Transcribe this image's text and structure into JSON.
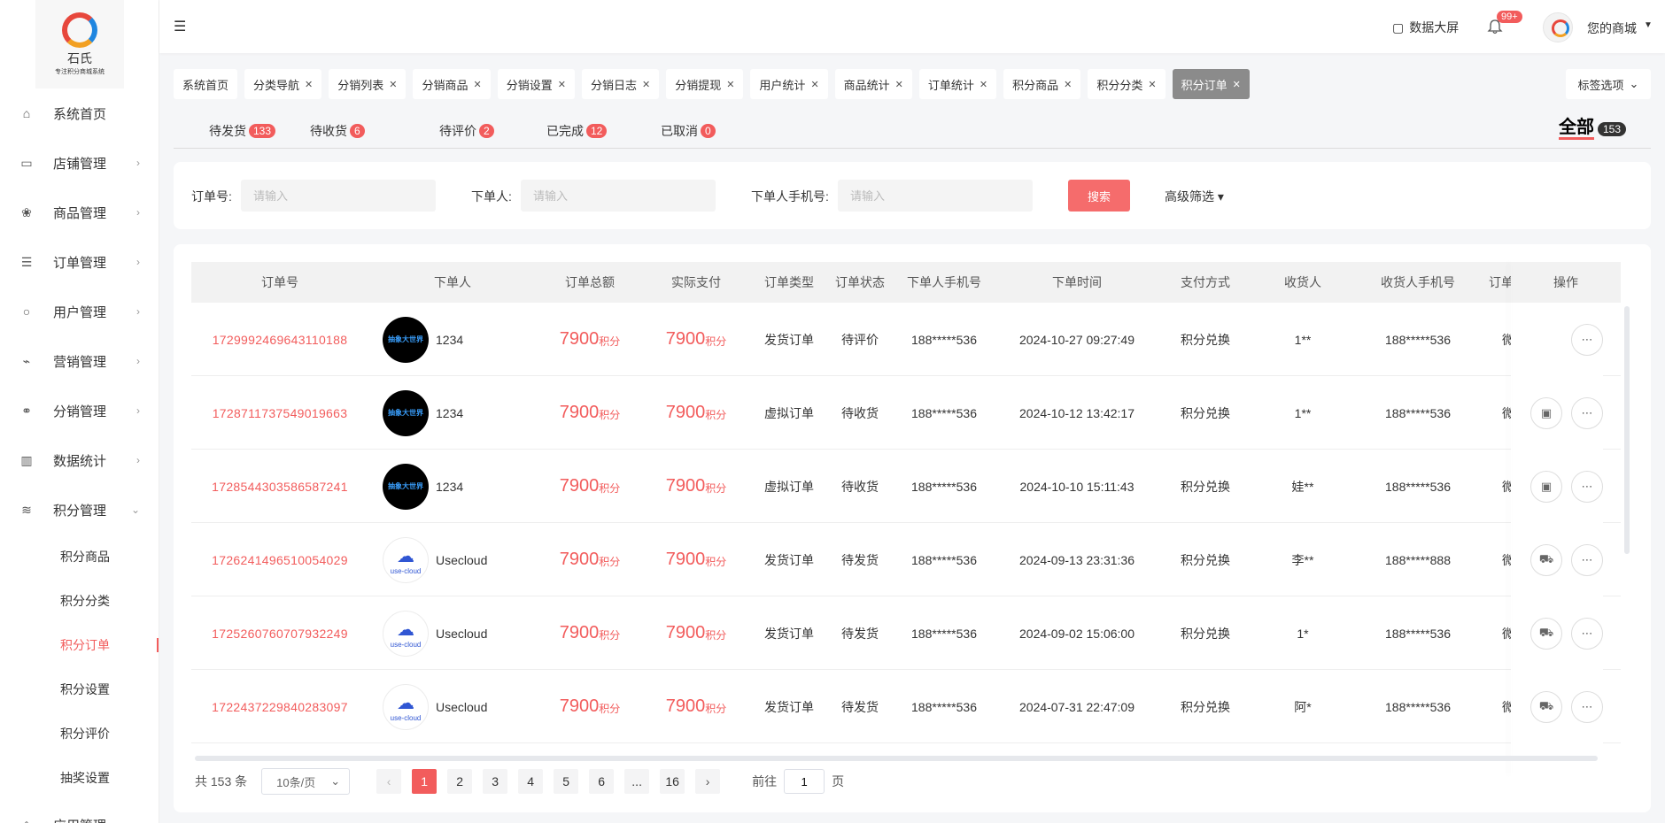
{
  "logo": {
    "brand": "石氏",
    "tagline": "专注积分商城系统"
  },
  "sidebar": {
    "items": [
      {
        "label": "系统首页",
        "icon": "home-icon",
        "has_arrow": false
      },
      {
        "label": "店铺管理",
        "icon": "store-icon",
        "has_arrow": true
      },
      {
        "label": "商品管理",
        "icon": "goods-icon",
        "has_arrow": true
      },
      {
        "label": "订单管理",
        "icon": "order-icon",
        "has_arrow": true
      },
      {
        "label": "用户管理",
        "icon": "user-icon",
        "has_arrow": true
      },
      {
        "label": "营销管理",
        "icon": "marketing-icon",
        "has_arrow": true
      },
      {
        "label": "分销管理",
        "icon": "distribution-icon",
        "has_arrow": true
      },
      {
        "label": "数据统计",
        "icon": "chart-icon",
        "has_arrow": true
      },
      {
        "label": "积分管理",
        "icon": "database-icon",
        "has_arrow": true,
        "expanded": true
      }
    ],
    "submenu": [
      "积分商品",
      "积分分类",
      "积分订单",
      "积分设置",
      "积分评价",
      "抽奖设置"
    ],
    "active_sub": "积分订单",
    "next_item": "应用管理"
  },
  "header": {
    "data_screen": "数据大屏",
    "notif_badge": "99+",
    "shop_name": "您的商城"
  },
  "tags": {
    "items": [
      "系统首页",
      "分类导航",
      "分销列表",
      "分销商品",
      "分销设置",
      "分销日志",
      "分销提现",
      "用户统计",
      "商品统计",
      "订单统计",
      "积分商品",
      "积分分类",
      "积分订单"
    ],
    "active": "积分订单",
    "options_label": "标签选项"
  },
  "status_tabs": [
    {
      "label": "待发货",
      "count": "133"
    },
    {
      "label": "待收货",
      "count": "6"
    },
    {
      "label": "待评价",
      "count": "2"
    },
    {
      "label": "已完成",
      "count": "12"
    },
    {
      "label": "已取消",
      "count": "0"
    }
  ],
  "status_all": {
    "label": "全部",
    "count": "153"
  },
  "search": {
    "order_no_label": "订单号:",
    "order_no_placeholder": "请输入",
    "buyer_label": "下单人:",
    "buyer_placeholder": "请输入",
    "phone_label": "下单人手机号:",
    "phone_placeholder": "请输入",
    "search_button": "搜索",
    "advanced": "高级筛选"
  },
  "table": {
    "columns": [
      "订单号",
      "下单人",
      "订单总额",
      "实际支付",
      "订单类型",
      "订单状态",
      "下单人手机号",
      "下单时间",
      "支付方式",
      "收货人",
      "收货人手机号",
      "订单来源",
      "操作"
    ],
    "rows": [
      {
        "order_no": "1729992469643110188",
        "avatar": "dark",
        "buyer": "1234",
        "total": "7900",
        "paid": "7900",
        "unit": "积分",
        "type": "发货订单",
        "status": "待评价",
        "buyer_phone": "188*****536",
        "time": "2024-10-27 09:27:49",
        "pay": "积分兑换",
        "receiver": "1**",
        "receiver_phone": "188*****536",
        "source": "微信",
        "ops": [
          "more"
        ]
      },
      {
        "order_no": "1728711737549019663",
        "avatar": "dark",
        "buyer": "1234",
        "total": "7900",
        "paid": "7900",
        "unit": "积分",
        "type": "虚拟订单",
        "status": "待收货",
        "buyer_phone": "188*****536",
        "time": "2024-10-12 13:42:17",
        "pay": "积分兑换",
        "receiver": "1**",
        "receiver_phone": "188*****536",
        "source": "微信",
        "ops": [
          "box",
          "more"
        ]
      },
      {
        "order_no": "1728544303586587241",
        "avatar": "dark",
        "buyer": "1234",
        "total": "7900",
        "paid": "7900",
        "unit": "积分",
        "type": "虚拟订单",
        "status": "待收货",
        "buyer_phone": "188*****536",
        "time": "2024-10-10 15:11:43",
        "pay": "积分兑换",
        "receiver": "娃**",
        "receiver_phone": "188*****536",
        "source": "微信",
        "ops": [
          "box",
          "more"
        ]
      },
      {
        "order_no": "1726241496510054029",
        "avatar": "cloud",
        "buyer": "Usecloud",
        "total": "7900",
        "paid": "7900",
        "unit": "积分",
        "type": "发货订单",
        "status": "待发货",
        "buyer_phone": "188*****536",
        "time": "2024-09-13 23:31:36",
        "pay": "积分兑换",
        "receiver": "李**",
        "receiver_phone": "188*****888",
        "source": "微信",
        "ops": [
          "truck",
          "more"
        ]
      },
      {
        "order_no": "1725260760707932249",
        "avatar": "cloud",
        "buyer": "Usecloud",
        "total": "7900",
        "paid": "7900",
        "unit": "积分",
        "type": "发货订单",
        "status": "待发货",
        "buyer_phone": "188*****536",
        "time": "2024-09-02 15:06:00",
        "pay": "积分兑换",
        "receiver": "1*",
        "receiver_phone": "188*****536",
        "source": "微信",
        "ops": [
          "truck",
          "more"
        ]
      },
      {
        "order_no": "1722437229840283097",
        "avatar": "cloud",
        "buyer": "Usecloud",
        "total": "7900",
        "paid": "7900",
        "unit": "积分",
        "type": "发货订单",
        "status": "待发货",
        "buyer_phone": "188*****536",
        "time": "2024-07-31 22:47:09",
        "pay": "积分兑换",
        "receiver": "阿*",
        "receiver_phone": "188*****536",
        "source": "微信",
        "ops": [
          "truck",
          "more"
        ]
      }
    ],
    "avatar_text_dark": "抽象大世界",
    "avatar_text_cloud": "use-cloud"
  },
  "pager": {
    "total": "共 153 条",
    "page_size": "10条/页",
    "pages": [
      "1",
      "2",
      "3",
      "4",
      "5",
      "6",
      "...",
      "16"
    ],
    "current": "1",
    "goto_prefix": "前往",
    "goto_value": "1",
    "goto_suffix": "页"
  },
  "colors": {
    "accent": "#f25c5c",
    "active_tag": "#8b8b8b"
  }
}
